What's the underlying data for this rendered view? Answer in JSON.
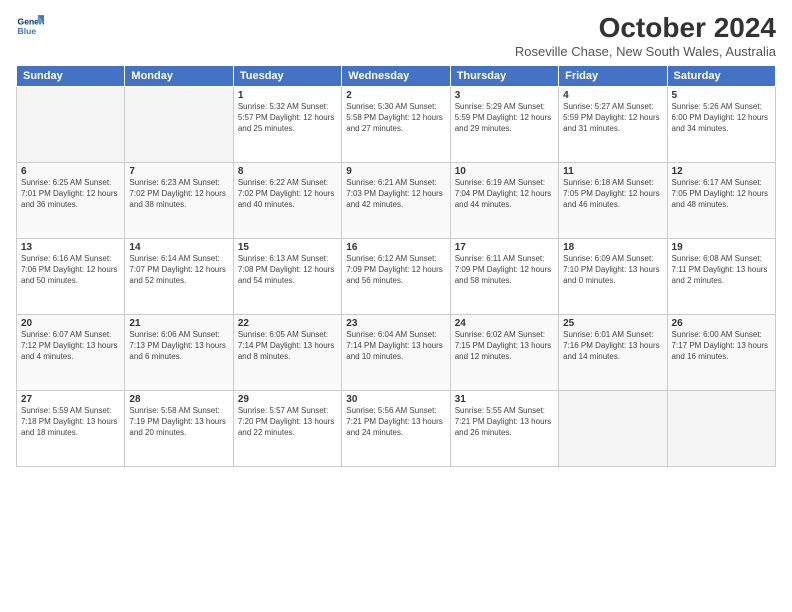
{
  "logo": {
    "line1": "General",
    "line2": "Blue"
  },
  "title": "October 2024",
  "subtitle": "Roseville Chase, New South Wales, Australia",
  "days_header": [
    "Sunday",
    "Monday",
    "Tuesday",
    "Wednesday",
    "Thursday",
    "Friday",
    "Saturday"
  ],
  "weeks": [
    [
      {
        "day": "",
        "info": ""
      },
      {
        "day": "",
        "info": ""
      },
      {
        "day": "1",
        "info": "Sunrise: 5:32 AM\nSunset: 5:57 PM\nDaylight: 12 hours\nand 25 minutes."
      },
      {
        "day": "2",
        "info": "Sunrise: 5:30 AM\nSunset: 5:58 PM\nDaylight: 12 hours\nand 27 minutes."
      },
      {
        "day": "3",
        "info": "Sunrise: 5:29 AM\nSunset: 5:59 PM\nDaylight: 12 hours\nand 29 minutes."
      },
      {
        "day": "4",
        "info": "Sunrise: 5:27 AM\nSunset: 5:59 PM\nDaylight: 12 hours\nand 31 minutes."
      },
      {
        "day": "5",
        "info": "Sunrise: 5:26 AM\nSunset: 6:00 PM\nDaylight: 12 hours\nand 34 minutes."
      }
    ],
    [
      {
        "day": "6",
        "info": "Sunrise: 6:25 AM\nSunset: 7:01 PM\nDaylight: 12 hours\nand 36 minutes."
      },
      {
        "day": "7",
        "info": "Sunrise: 6:23 AM\nSunset: 7:02 PM\nDaylight: 12 hours\nand 38 minutes."
      },
      {
        "day": "8",
        "info": "Sunrise: 6:22 AM\nSunset: 7:02 PM\nDaylight: 12 hours\nand 40 minutes."
      },
      {
        "day": "9",
        "info": "Sunrise: 6:21 AM\nSunset: 7:03 PM\nDaylight: 12 hours\nand 42 minutes."
      },
      {
        "day": "10",
        "info": "Sunrise: 6:19 AM\nSunset: 7:04 PM\nDaylight: 12 hours\nand 44 minutes."
      },
      {
        "day": "11",
        "info": "Sunrise: 6:18 AM\nSunset: 7:05 PM\nDaylight: 12 hours\nand 46 minutes."
      },
      {
        "day": "12",
        "info": "Sunrise: 6:17 AM\nSunset: 7:05 PM\nDaylight: 12 hours\nand 48 minutes."
      }
    ],
    [
      {
        "day": "13",
        "info": "Sunrise: 6:16 AM\nSunset: 7:06 PM\nDaylight: 12 hours\nand 50 minutes."
      },
      {
        "day": "14",
        "info": "Sunrise: 6:14 AM\nSunset: 7:07 PM\nDaylight: 12 hours\nand 52 minutes."
      },
      {
        "day": "15",
        "info": "Sunrise: 6:13 AM\nSunset: 7:08 PM\nDaylight: 12 hours\nand 54 minutes."
      },
      {
        "day": "16",
        "info": "Sunrise: 6:12 AM\nSunset: 7:09 PM\nDaylight: 12 hours\nand 56 minutes."
      },
      {
        "day": "17",
        "info": "Sunrise: 6:11 AM\nSunset: 7:09 PM\nDaylight: 12 hours\nand 58 minutes."
      },
      {
        "day": "18",
        "info": "Sunrise: 6:09 AM\nSunset: 7:10 PM\nDaylight: 13 hours\nand 0 minutes."
      },
      {
        "day": "19",
        "info": "Sunrise: 6:08 AM\nSunset: 7:11 PM\nDaylight: 13 hours\nand 2 minutes."
      }
    ],
    [
      {
        "day": "20",
        "info": "Sunrise: 6:07 AM\nSunset: 7:12 PM\nDaylight: 13 hours\nand 4 minutes."
      },
      {
        "day": "21",
        "info": "Sunrise: 6:06 AM\nSunset: 7:13 PM\nDaylight: 13 hours\nand 6 minutes."
      },
      {
        "day": "22",
        "info": "Sunrise: 6:05 AM\nSunset: 7:14 PM\nDaylight: 13 hours\nand 8 minutes."
      },
      {
        "day": "23",
        "info": "Sunrise: 6:04 AM\nSunset: 7:14 PM\nDaylight: 13 hours\nand 10 minutes."
      },
      {
        "day": "24",
        "info": "Sunrise: 6:02 AM\nSunset: 7:15 PM\nDaylight: 13 hours\nand 12 minutes."
      },
      {
        "day": "25",
        "info": "Sunrise: 6:01 AM\nSunset: 7:16 PM\nDaylight: 13 hours\nand 14 minutes."
      },
      {
        "day": "26",
        "info": "Sunrise: 6:00 AM\nSunset: 7:17 PM\nDaylight: 13 hours\nand 16 minutes."
      }
    ],
    [
      {
        "day": "27",
        "info": "Sunrise: 5:59 AM\nSunset: 7:18 PM\nDaylight: 13 hours\nand 18 minutes."
      },
      {
        "day": "28",
        "info": "Sunrise: 5:58 AM\nSunset: 7:19 PM\nDaylight: 13 hours\nand 20 minutes."
      },
      {
        "day": "29",
        "info": "Sunrise: 5:57 AM\nSunset: 7:20 PM\nDaylight: 13 hours\nand 22 minutes."
      },
      {
        "day": "30",
        "info": "Sunrise: 5:56 AM\nSunset: 7:21 PM\nDaylight: 13 hours\nand 24 minutes."
      },
      {
        "day": "31",
        "info": "Sunrise: 5:55 AM\nSunset: 7:21 PM\nDaylight: 13 hours\nand 26 minutes."
      },
      {
        "day": "",
        "info": ""
      },
      {
        "day": "",
        "info": ""
      }
    ]
  ]
}
